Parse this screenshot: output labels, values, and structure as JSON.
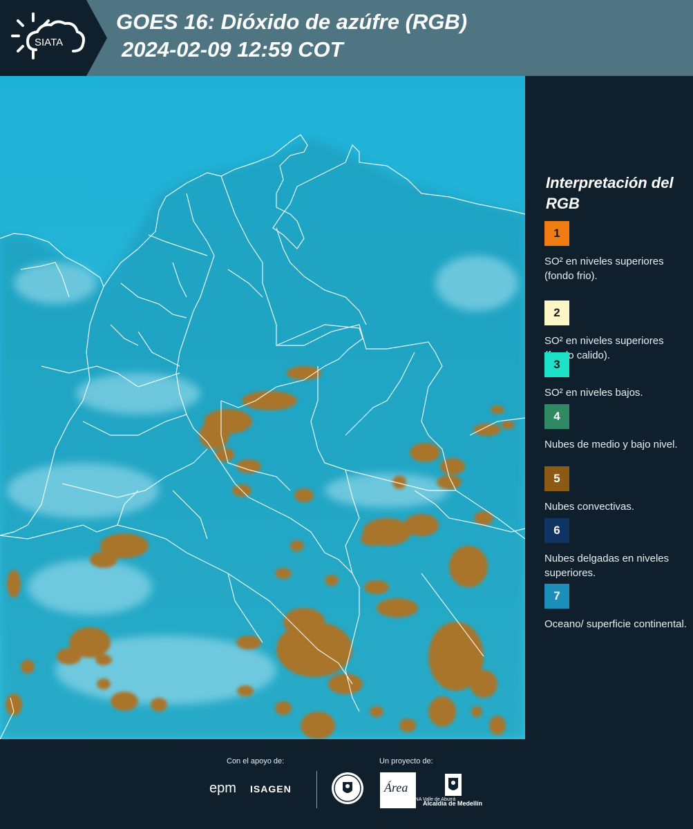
{
  "header": {
    "logo_text": "SIATA",
    "title_line1": "GOES 16: Dióxido de azúfre (RGB)",
    "title_line2": "2024-02-09 12:59 COT"
  },
  "legend": {
    "title": "Interpretación del RGB",
    "items": [
      {
        "number": "1",
        "color": "#f07d14",
        "number_color": "#1a1a1a",
        "text": "SO² en niveles superiores (fondo frio)."
      },
      {
        "number": "2",
        "color": "#fdf6c6",
        "number_color": "#1a1a1a",
        "text": "SO² en niveles superiores (fondo calido)."
      },
      {
        "number": "3",
        "color": "#1de2c8",
        "number_color": "#1a1a1a",
        "text": "SO² en niveles bajos."
      },
      {
        "number": "4",
        "color": "#2f8a63",
        "number_color": "#ffffff",
        "text": "Nubes de medio y bajo nivel."
      },
      {
        "number": "5",
        "color": "#8c5a14",
        "number_color": "#ffffff",
        "text": "Nubes convectivas."
      },
      {
        "number": "6",
        "color": "#0f3362",
        "number_color": "#ffffff",
        "text": "Nubes delgadas en niveles superiores."
      },
      {
        "number": "7",
        "color": "#1b8fb9",
        "number_color": "#ffffff",
        "text": "Oceano/ superficie continental."
      }
    ]
  },
  "map": {
    "ocean_color": "#22b3d6",
    "cloud_color": "#a8742a",
    "border_color": "#ffffff"
  },
  "footer": {
    "support_label": "Con el apoyo de:",
    "project_label": "Un proyecto de:",
    "sponsor1": "epm",
    "sponsor2": "ISAGEN",
    "partner1": "Área",
    "partner1_sub": "METROPOLITANA Valle de Aburrá",
    "partner2": "Alcaldía de Medellín"
  }
}
